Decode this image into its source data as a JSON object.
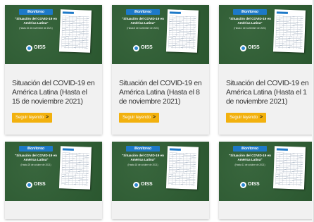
{
  "cards": [
    {
      "badge": "Monitoreo",
      "thumb_title": "\"Situación del COVID-19 en América Latina\"",
      "thumb_sub": "(Hasta 15 de noviembre de 2021)",
      "logo": "OISS",
      "title": "Situación del COVID-19 en América Latina (Hasta el 15 de noviembre 2021)",
      "button": "Seguir leyendo",
      "button_icon": "chevron-right-icon"
    },
    {
      "badge": "Monitoreo",
      "thumb_title": "\"Situación del COVID-19 en América Latina\"",
      "thumb_sub": "(Hasta 8 de noviembre de 2021)",
      "logo": "OISS",
      "title": "Situación del COVID-19 en América Latina (Hasta el 8 de noviembre 2021)",
      "button": "Seguir leyendo",
      "button_icon": "chevron-right-icon"
    },
    {
      "badge": "Monitoreo",
      "thumb_title": "\"Situación del COVID-19 en América Latina\"",
      "thumb_sub": "(Hasta 1 de noviembre de 2021)",
      "logo": "OISS",
      "title": "Situación del COVID-19 en América Latina (Hasta el 1 de noviembre 2021)",
      "button": "Seguir leyendo",
      "button_icon": "chevron-right-icon"
    },
    {
      "badge": "Monitoreo",
      "thumb_title": "\"Situación del COVID-19 en América Latina\"",
      "thumb_sub": "(Hasta 25 de octubre de 2021)",
      "logo": "OISS"
    },
    {
      "badge": "Monitoreo",
      "thumb_title": "\"Situación del COVID-19 en América Latina\"",
      "thumb_sub": "(Hasta 18 de octubre de 2021)",
      "logo": "OISS"
    },
    {
      "badge": "Monitoreo",
      "thumb_title": "\"Situación del COVID-19 en América Latina\"",
      "thumb_sub": "(Hasta 11 de octubre de 2021)",
      "logo": "OISS"
    }
  ],
  "colors": {
    "thumb_green": "#2e5e33",
    "badge_blue": "#1d79c8",
    "button_yellow": "#f2b10e",
    "card_bg": "#f1f1f1",
    "title_text": "#333333"
  }
}
